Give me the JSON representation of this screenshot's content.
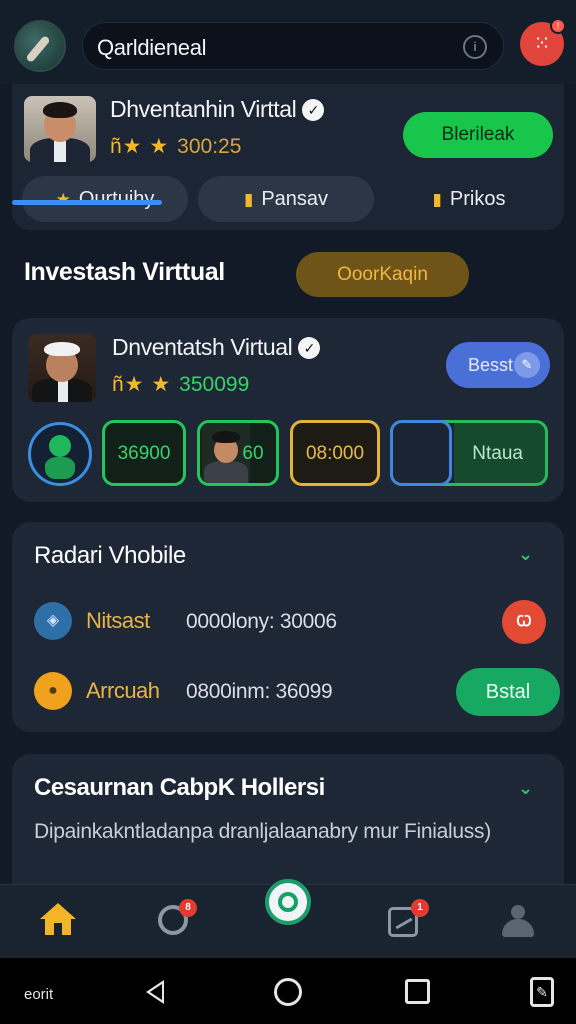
{
  "header": {
    "search_text": "Qarldieneal",
    "search_icon": "info-icon",
    "notification_icon": "dice-icon"
  },
  "profile_card": {
    "name": "Dhventanhin Virttal",
    "stars": "ñ★ ★",
    "rating_value": "300:25",
    "action_button": "Blerileak",
    "tabs": [
      {
        "icon": "★",
        "label": "Ourtuihy"
      },
      {
        "icon": "▮",
        "label": "Pansav"
      },
      {
        "icon": "▮",
        "label": "Prikos"
      }
    ]
  },
  "section": {
    "title": "Investash Virttual",
    "pill_label": "OoorKaqin"
  },
  "investment_card": {
    "name": "Dnventatsh Virtual",
    "stars": "ñ★ ★",
    "rating_value": "350099",
    "badge_button": "Besst",
    "boxes": [
      "36900",
      "60",
      "08:000",
      "Ntaua"
    ]
  },
  "mobile_card": {
    "title": "Radari Vhobile",
    "rows": [
      {
        "label": "Nitsast",
        "value": "0000lony: 30006",
        "action": "Ꞷ"
      },
      {
        "label": "Arrcuah",
        "value": "0800inm: 36099",
        "action": "Bstal"
      }
    ]
  },
  "info_card": {
    "title": "Cesaurnan CabpK Hollersi",
    "description": "Dipainkakntladanpa dranljalaanabry mur Finialuss)"
  },
  "bottom_nav": {
    "items": [
      "home-icon",
      "settings-icon",
      "center-action-icon",
      "chart-icon",
      "profile-icon"
    ],
    "badges": [
      "8",
      "1"
    ]
  },
  "system_bar": {
    "time": "eorit"
  },
  "colors": {
    "background": "#111a26",
    "card": "#1d2736",
    "accent_green": "#18c64b",
    "accent_gold": "#f5b82a",
    "accent_blue": "#4a6fd6",
    "accent_red": "#e24a34"
  }
}
